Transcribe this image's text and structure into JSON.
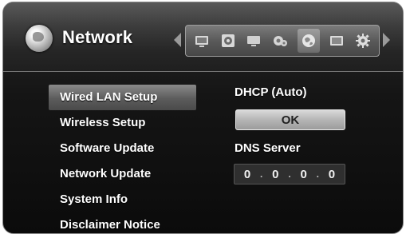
{
  "header": {
    "title": "Network",
    "icons": [
      "tv-icon",
      "disc-icon",
      "display-icon",
      "settings-gear-icon",
      "network-globe-icon",
      "picture-icon",
      "gear-icon"
    ],
    "selected_icon": "network-globe-icon"
  },
  "menu": {
    "items": [
      {
        "label": "Wired LAN Setup",
        "active": true
      },
      {
        "label": "Wireless Setup",
        "active": false
      },
      {
        "label": "Software Update",
        "active": false
      },
      {
        "label": "Network Update",
        "active": false
      },
      {
        "label": "System Info",
        "active": false
      },
      {
        "label": "Disclaimer Notice",
        "active": false
      }
    ]
  },
  "panel": {
    "dhcp_label": "DHCP (Auto)",
    "ok_label": "OK",
    "dns_label": "DNS Server",
    "dns_octets": [
      "0",
      "0",
      "0",
      "0"
    ]
  },
  "colors": {
    "background": "#0b0b0b",
    "highlight": "#8a8a8a",
    "text": "#ffffff"
  }
}
